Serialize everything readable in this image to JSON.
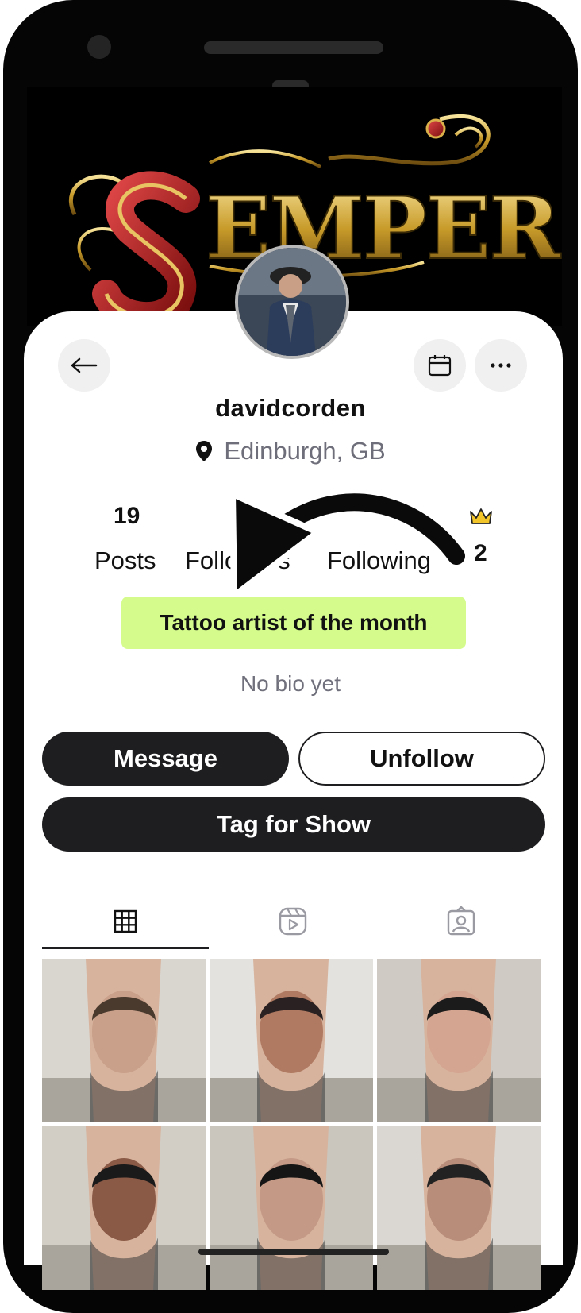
{
  "profile": {
    "username": "davidcorden",
    "location": "Edinburgh, GB",
    "banner_text": "SEMPER",
    "bio": "No bio yet",
    "badge": "Tattoo artist of the month"
  },
  "stats": {
    "posts_count": "19",
    "posts_label": "Posts",
    "followers_label": "Followers",
    "following_label": "Following",
    "crown_count": "2"
  },
  "actions": {
    "message": "Message",
    "unfollow": "Unfollow",
    "tag_for_show": "Tag for Show"
  },
  "tabs": [
    {
      "icon": "grid-icon",
      "active": true
    },
    {
      "icon": "reels-icon",
      "active": false
    },
    {
      "icon": "tagged-icon",
      "active": false
    }
  ],
  "colors": {
    "badge_bg": "#d4fb8c",
    "dark_button": "#1e1e20",
    "crown": "#f2c52b",
    "muted_text": "#6e6e7a"
  },
  "posts": [
    {
      "skin": "#c9a08a",
      "hair": "#4a3a2e",
      "bg": "#d9d6d0"
    },
    {
      "skin": "#b07a62",
      "hair": "#2a2222",
      "bg": "#e4e2de"
    },
    {
      "skin": "#d4a590",
      "hair": "#1b1b1b",
      "bg": "#cfcbc4"
    },
    {
      "skin": "#8a5a47",
      "hair": "#1a1a1a",
      "bg": "#d2cec6"
    },
    {
      "skin": "#c49a86",
      "hair": "#151515",
      "bg": "#cac6bd"
    },
    {
      "skin": "#b88d79",
      "hair": "#222222",
      "bg": "#dad7d2"
    }
  ]
}
